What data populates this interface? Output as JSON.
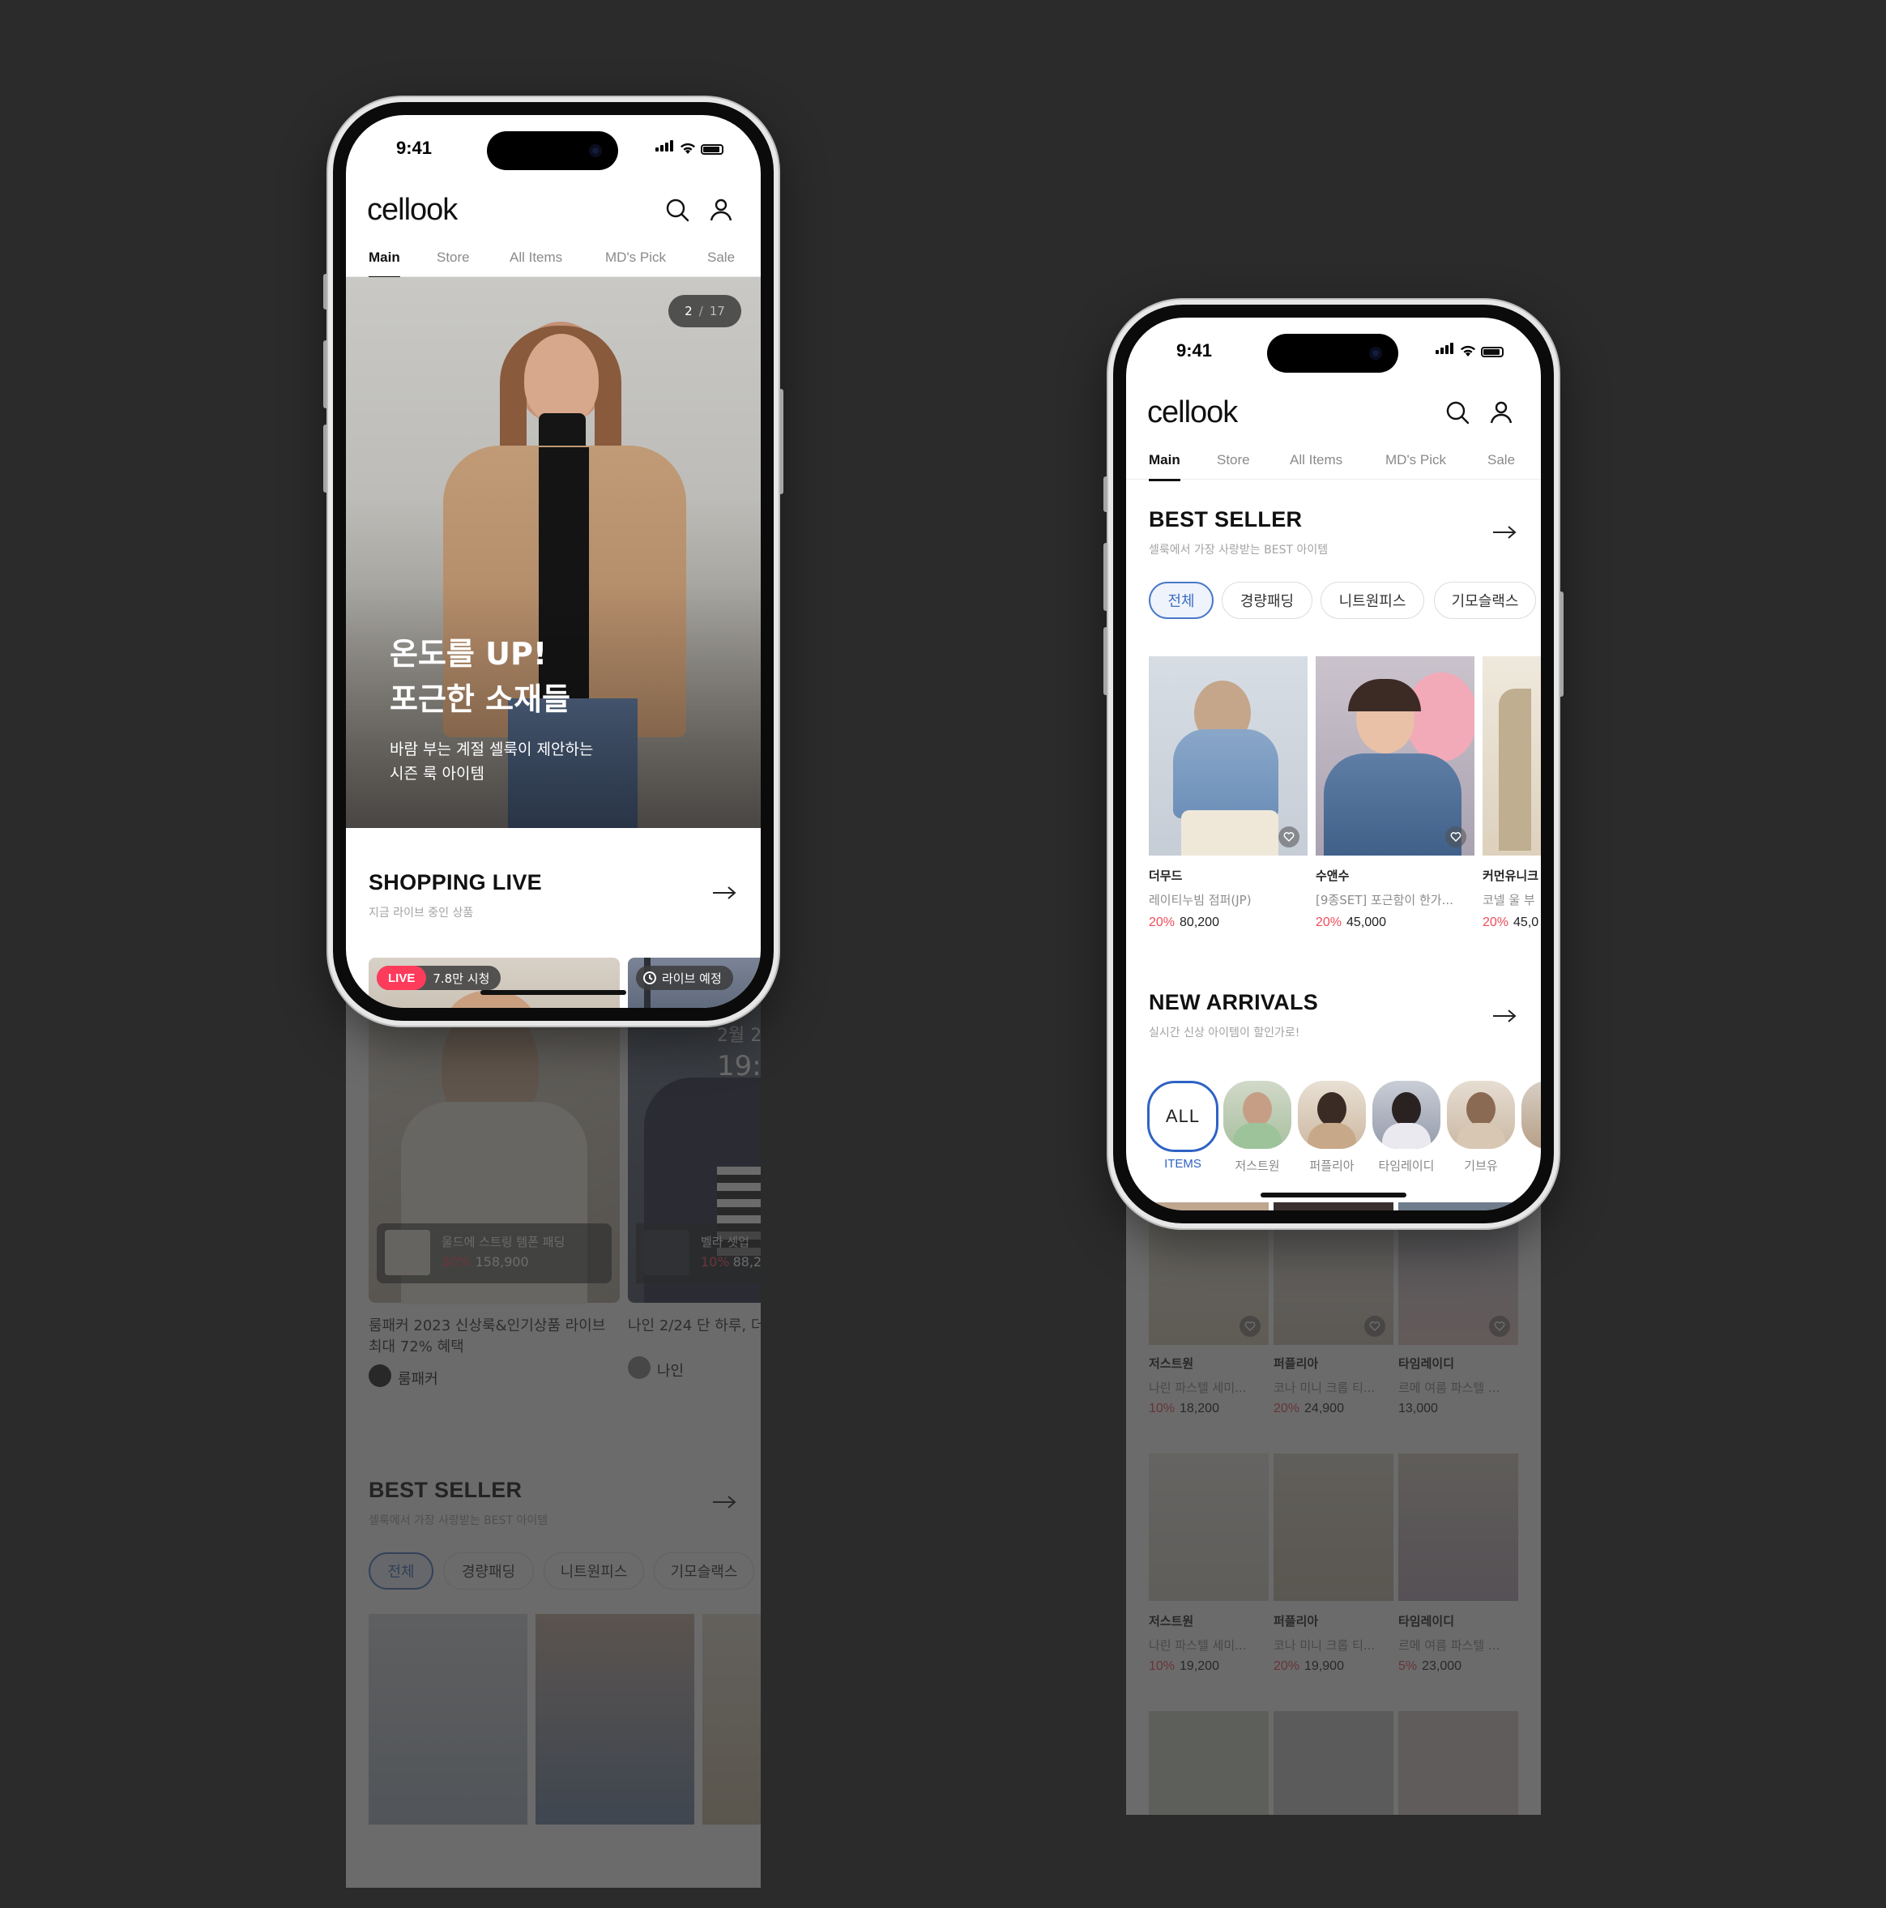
{
  "status": {
    "time": "9:41"
  },
  "app": {
    "logo": "cellook",
    "tabs": [
      "Main",
      "Store",
      "All Items",
      "MD's Pick",
      "Sale"
    ]
  },
  "left_phone": {
    "banner": {
      "page": "2",
      "sep": "/",
      "total": "17",
      "headline_1": "온도를 UP!",
      "headline_2": "포근한 소재들",
      "sub_1": "바람 부는 계절 셀룩이 제안하는",
      "sub_2": "시즌 룩 아이템"
    },
    "shopping_live": {
      "title": "SHOPPING LIVE",
      "subtitle": "지금 라이브 중인 상품",
      "live_badge": "LIVE",
      "viewers": "7.8만 시청",
      "upcoming": "라이브 예정",
      "cards": [
        {
          "product": "울드에 스트링 템폰 패딩",
          "discount": "30%",
          "price": "158,900",
          "title_1": "룸패커 2023 신상룩&인기상품 라이브",
          "title_2": "최대 72% 혜택",
          "store": "룸패커"
        },
        {
          "product": "벨라 셋업",
          "discount": "10%",
          "price": "88,2",
          "date": "2월 2",
          "clock": "19:",
          "title_1": "나인 2/24 단 하루, 더",
          "store": "나인"
        }
      ]
    },
    "best_seller": {
      "title": "BEST SELLER",
      "subtitle": "셀룩에서 가장 사랑받는 BEST 아이템",
      "chips": [
        "전체",
        "경량패딩",
        "니트원피스",
        "기모슬랙스"
      ]
    }
  },
  "right_phone": {
    "best_seller": {
      "title": "BEST SELLER",
      "subtitle": "셀룩에서 가장 사랑받는 BEST 아이템",
      "chips": [
        "전체",
        "경량패딩",
        "니트원피스",
        "기모슬랙스"
      ],
      "products": [
        {
          "brand": "더무드",
          "name": "레이티누빔 점퍼(JP)",
          "discount": "20%",
          "price": "80,200"
        },
        {
          "brand": "수앤수",
          "name": "[9종SET] 포근함이 한가...",
          "discount": "20%",
          "price": "45,000"
        },
        {
          "brand": "커먼유니크",
          "name": "코넬 울 부",
          "discount": "20%",
          "price": "45,0"
        }
      ]
    },
    "new_arrivals": {
      "title": "NEW ARRIVALS",
      "subtitle": "실시간 신상 아이템이 할인가로!",
      "all_label": "ALL",
      "all_caption": "ITEMS",
      "stores": [
        "저스트원",
        "퍼플리아",
        "타임레이디",
        "기브유"
      ]
    },
    "grid": [
      {
        "brand": "저스트원",
        "name": "나린 파스텔 세미...",
        "discount": "10%",
        "price": "18,200"
      },
      {
        "brand": "퍼플리아",
        "name": "코나 미니 크롭 티...",
        "discount": "20%",
        "price": "24,900"
      },
      {
        "brand": "타임레이디",
        "name": "르메 여름 파스텔 ...",
        "discount": "",
        "price": "13,000"
      },
      {
        "brand": "저스트원",
        "name": "나린 파스텔 세미...",
        "discount": "10%",
        "price": "19,200"
      },
      {
        "brand": "퍼플리아",
        "name": "코나 미니 크롭 티...",
        "discount": "20%",
        "price": "19,900"
      },
      {
        "brand": "타임레이디",
        "name": "르메 여름 파스텔 ...",
        "discount": "5%",
        "price": "23,000"
      }
    ]
  },
  "colors": {
    "background": "#2b2b2b",
    "accent_blue": "#3e6ec2",
    "sale_red": "#ee4d5a",
    "live_red": "#ff3b5c"
  },
  "icons": [
    "search-icon",
    "user-icon",
    "arrow-right-icon",
    "heart-icon",
    "clock-icon",
    "signal-icon",
    "wifi-icon",
    "battery-icon"
  ]
}
